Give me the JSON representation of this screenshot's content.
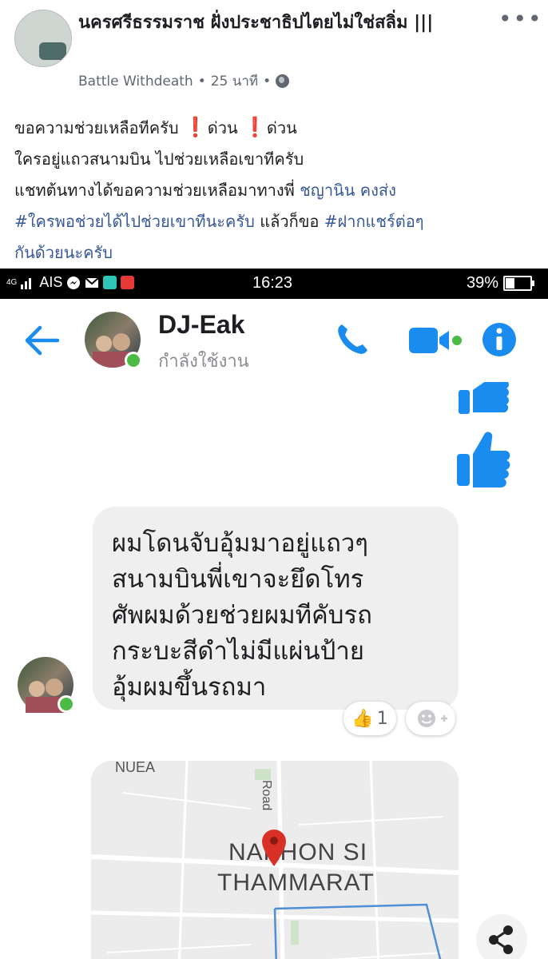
{
  "post": {
    "group_name": "นครศรีธรรมราช ฝั่งประชาธิปไตยไม่ใช่สลิ่ม |||",
    "author": "Battle Withdeath",
    "time": "25 นาที",
    "line1_a": "ขอความช่วยเหลือทีครับ",
    "line1_b": "ด่วน",
    "line1_c": "ด่วน",
    "line2": "ใครอยู่แถวสนามบิน ไปช่วยเหลือเขาทีครับ",
    "line3_a": "แชทต้นทางได้ขอความช่วยเหลือมาทางพี่",
    "line3_link": "ชญานิน คงส่ง",
    "line4_hashtag1": "#ใครพอช่วยได้ไปช่วยเขาทีนะครับ",
    "line4_mid": "แล้วก็ขอ",
    "line4_hashtag2": "#ฝากแชร์ต่อๆ",
    "line5": "กันด้วยนะครับ",
    "more_icon": "more-horizontal-icon",
    "excl_glyph": "❗"
  },
  "status_bar": {
    "network": "4G",
    "carrier": "AIS",
    "time": "16:23",
    "battery": "39%"
  },
  "messenger": {
    "contact_name": "DJ-Eak",
    "contact_status": "กำลังใช้งาน",
    "accent_color": "#1a8cf0",
    "online_color": "#4cbb46",
    "message": "ผมโดนจับอุ้มมาอยู่แถวๆ\nสนามบินพี่เขาจะยึดโทร\nศัพผมด้วยช่วยผมทีคับรถ\nกระบะสีดำไม่มีแผ่นป้าย\nอุ้มผมขึ้นรถมา",
    "reaction_emoji": "👍",
    "reaction_count": "1",
    "add_reaction_icon": "add-emoji-icon",
    "map": {
      "label_top": "NUEA",
      "label_road": "Road",
      "label_city1": "NAKHON SI",
      "label_city2": "THAMMARAT"
    }
  }
}
